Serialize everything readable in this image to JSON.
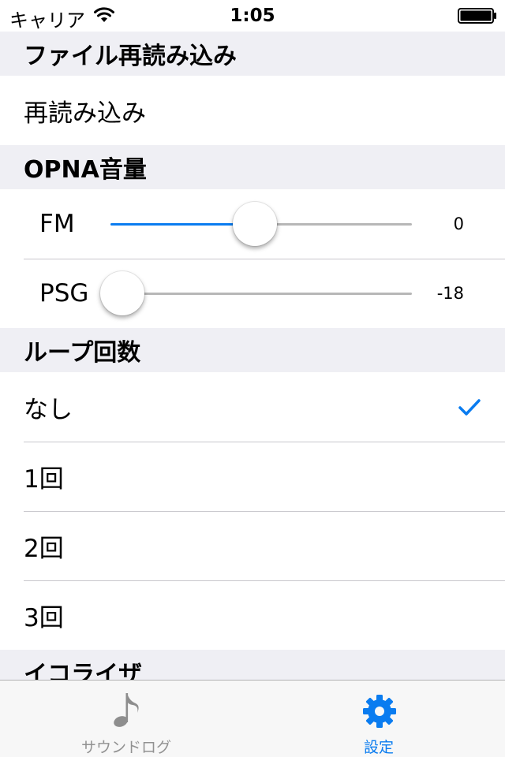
{
  "status_bar": {
    "carrier": "キャリア",
    "time": "1:05"
  },
  "sections": {
    "reload": {
      "header": "ファイル再読み込み",
      "item": "再読み込み"
    },
    "volume": {
      "header": "OPNA音量",
      "fm": {
        "label": "FM",
        "value": "0",
        "level": 0.48
      },
      "psg": {
        "label": "PSG",
        "value": "-18",
        "level": 0.04
      }
    },
    "loop": {
      "header": "ループ回数",
      "options": [
        "なし",
        "1回",
        "2回",
        "3回"
      ],
      "selected": "なし"
    },
    "equalizer": {
      "header": "イコライザ"
    }
  },
  "tab_bar": {
    "tabs": [
      {
        "label": "サウンドログ",
        "icon": "music-note-icon",
        "active": false
      },
      {
        "label": "設定",
        "icon": "gear-icon",
        "active": true
      }
    ]
  },
  "colors": {
    "accent": "#0a7cf0",
    "background": "#efeff4",
    "separator": "#c8c7cc"
  }
}
